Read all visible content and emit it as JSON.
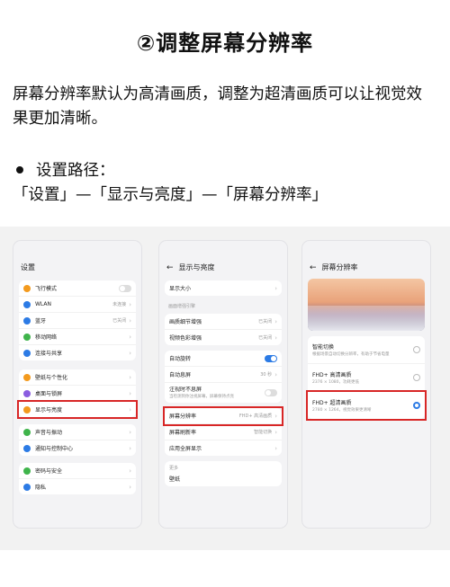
{
  "title": "②调整屏幕分辨率",
  "paragraph": "屏幕分辨率默认为高清画质，调整为超清画质可以让视觉效果更加清晰。",
  "bullet": "设置路径：",
  "path": "「设置」—「显示与亮度」—「屏幕分辨率」",
  "screen1": {
    "header": "设置",
    "items": [
      {
        "label": "飞行模式",
        "value": "",
        "icon": "airplane-icon",
        "color": "#f39a1e"
      },
      {
        "label": "WLAN",
        "value": "未连接",
        "icon": "wifi-icon",
        "color": "#2c7be5"
      },
      {
        "label": "蓝牙",
        "value": "已关闭",
        "icon": "bluetooth-icon",
        "color": "#2c7be5"
      },
      {
        "label": "移动网络",
        "value": "",
        "icon": "mobile-network-icon",
        "color": "#3fb44b"
      },
      {
        "label": "连接与共享",
        "value": "",
        "icon": "share-icon",
        "color": "#2c7be5"
      },
      {
        "label": "壁纸与个性化",
        "value": "",
        "icon": "wallpaper-icon",
        "color": "#f39a1e"
      },
      {
        "label": "桌面与锁屏",
        "value": "",
        "icon": "desktop-icon",
        "color": "#8a5de0"
      },
      {
        "label": "显示与亮度",
        "value": "",
        "icon": "display-icon",
        "color": "#f39a1e"
      },
      {
        "label": "声音与振动",
        "value": "",
        "icon": "sound-icon",
        "color": "#3fb44b"
      },
      {
        "label": "通知与控制中心",
        "value": "",
        "icon": "notification-icon",
        "color": "#2c7be5"
      },
      {
        "label": "密码与安全",
        "value": "",
        "icon": "lock-icon",
        "color": "#3fb44b"
      },
      {
        "label": "隐私",
        "value": "",
        "icon": "privacy-icon",
        "color": "#2c7be5"
      }
    ]
  },
  "screen2": {
    "header": "显示与亮度",
    "font_size": "显示大小",
    "section_label": "画面增强引擎",
    "enhance1": {
      "label": "画质细节增强",
      "value": "已关闭"
    },
    "enhance2": {
      "label": "视频色彩增强",
      "value": "已关闭"
    },
    "auto_rotate": "自动旋转",
    "auto_lock": {
      "label": "自动息屏",
      "value": "30 秒"
    },
    "gaze": {
      "label": "注视时不息屏",
      "desc": "当检测到你注视屏幕，屏幕保持点亮"
    },
    "resolution": {
      "label": "屏幕分辨率",
      "value": "FHD+ 高清画质"
    },
    "refresh": {
      "label": "屏幕刷新率",
      "value": "智能切换"
    },
    "fullscreen": "应用全屏显示",
    "section2": "更多",
    "wallpaper": "壁纸"
  },
  "screen3": {
    "header": "屏幕分辨率",
    "options": [
      {
        "label": "智能切换",
        "desc": "根据场景自动切换分辨率，有助于节省电量",
        "selected": false
      },
      {
        "label": "FHD+ 高清画质",
        "desc": "2376 × 1080，功耗更低",
        "selected": false
      },
      {
        "label": "FHD+ 超清画质",
        "desc": "2780 × 1264，视觉效果更清晰",
        "selected": true
      }
    ]
  }
}
